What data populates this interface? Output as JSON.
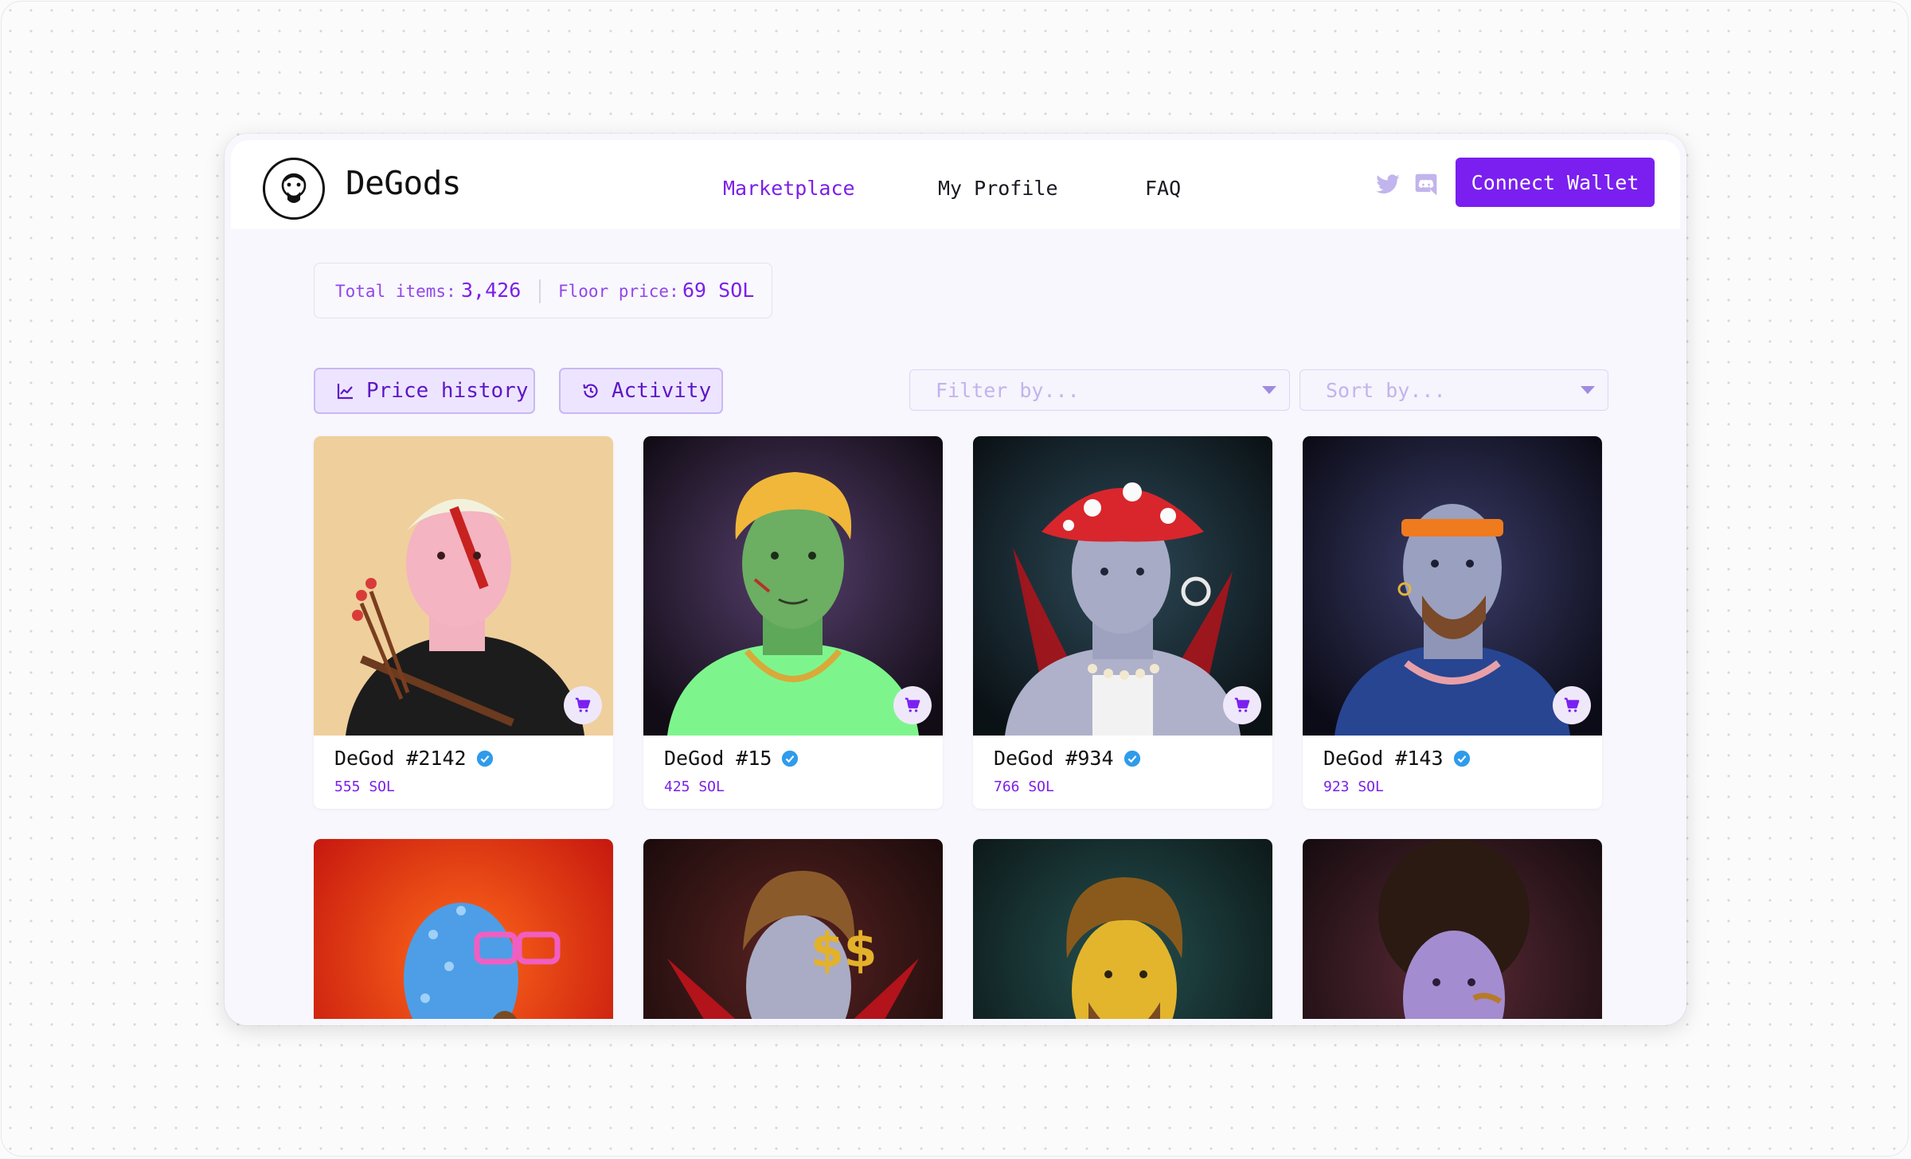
{
  "app": {
    "brand": "DeGods"
  },
  "nav": {
    "links": [
      {
        "label": "Marketplace",
        "active": true
      },
      {
        "label": "My Profile",
        "active": false
      },
      {
        "label": "FAQ",
        "active": false
      }
    ],
    "social_icons": [
      "twitter-icon",
      "discord-icon"
    ],
    "connect_label": "Connect Wallet"
  },
  "stats": {
    "total_label": "Total items:",
    "total_value": "3,426",
    "floor_label": "Floor price:",
    "floor_value": "69 SOL"
  },
  "actions": {
    "price_history": "Price history",
    "activity": "Activity"
  },
  "filters": {
    "filter_placeholder": "Filter by...",
    "sort_placeholder": "Sort by..."
  },
  "items": [
    {
      "name": "DeGod #2142",
      "price": "555 SOL"
    },
    {
      "name": "DeGod #15",
      "price": "425 SOL"
    },
    {
      "name": "DeGod #934",
      "price": "766 SOL"
    },
    {
      "name": "DeGod #143",
      "price": "923 SOL"
    },
    {
      "name": "",
      "price": ""
    },
    {
      "name": "",
      "price": ""
    },
    {
      "name": "",
      "price": ""
    },
    {
      "name": "",
      "price": ""
    }
  ],
  "colors": {
    "accent": "#7a1ff0",
    "accent_text": "#7c1fe8",
    "verified": "#2f9bea",
    "page_bg": "#f7f7fd"
  }
}
